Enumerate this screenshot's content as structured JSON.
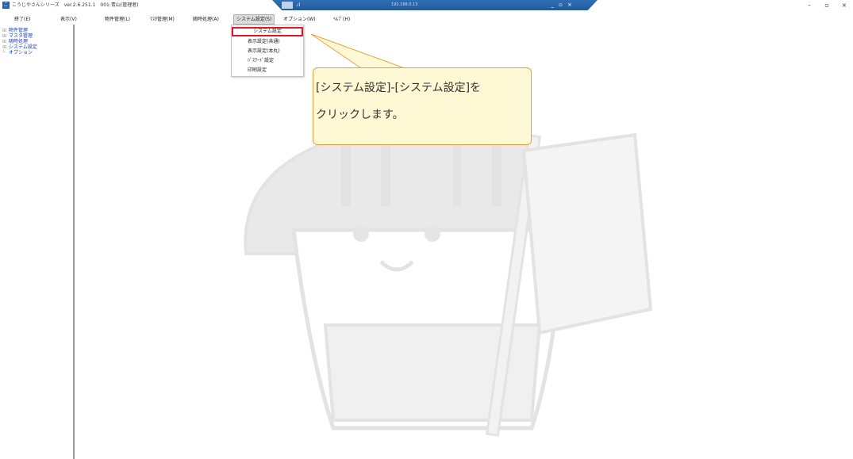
{
  "titlebar": {
    "app_icon": "こ",
    "title": "こうじやさんシリーズ　ver.2.6.251.1　001:青山(管理者)",
    "remote_ip": "192.168.0.13",
    "remote_signal": ".ıl",
    "remote_controls": "_ ▫ ×",
    "window_controls": [
      "–",
      "▫",
      "×"
    ]
  },
  "menubar": {
    "items": [
      "終了(E)",
      "表示(V)",
      "物件管理(L)",
      "ﾏｽﾀ管理(M)",
      "随時処理(A)",
      "システム設定(S)",
      "オプション(W)",
      "ﾍﾙﾌﾟ(H)"
    ]
  },
  "sidebar": {
    "items": [
      {
        "glyph": "⊞",
        "label": "物件管理"
      },
      {
        "glyph": "⊞",
        "label": "マスタ管理"
      },
      {
        "glyph": "⊞",
        "label": "随時処理"
      },
      {
        "glyph": "⊞",
        "label": "システム設定"
      },
      {
        "glyph": "└",
        "label": "オプション"
      }
    ]
  },
  "dropdown": {
    "items": [
      "システム設定",
      "表示設定(共通)",
      "表示設定(本丸)",
      "ﾊﾟｽﾜｰﾄﾞ設定",
      "印刷設定"
    ],
    "selected_index": 0
  },
  "callout": {
    "line1": "[システム設定]-[システム設定]を",
    "line2": "クリックします。"
  },
  "colors": {
    "highlight_border": "#e0162b",
    "callout_bg": "#fff8d4",
    "callout_border": "#e6a23a",
    "remote_bar": "#2f6fb5",
    "tree_label": "#1a3fb0"
  }
}
